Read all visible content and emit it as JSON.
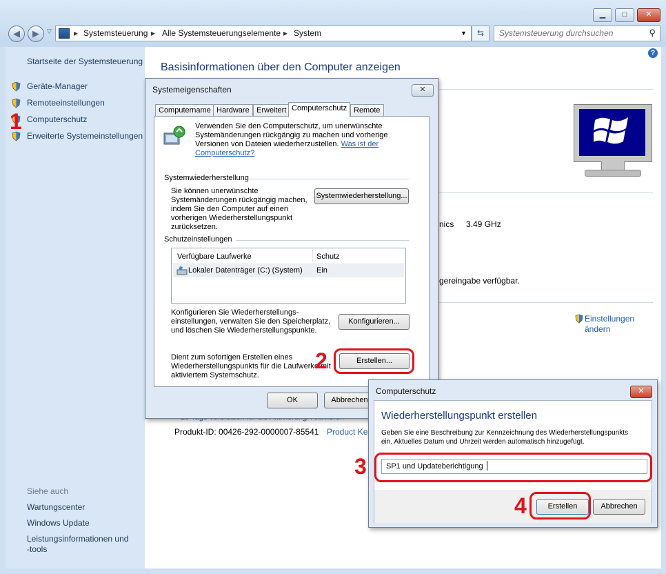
{
  "window": {
    "breadcrumbs": [
      "Systemsteuerung",
      "Alle Systemsteuerungselemente",
      "System"
    ],
    "search_placeholder": "Systemsteuerung durchsuchen",
    "caption_minimize": "▁",
    "caption_maximize": "□",
    "caption_close": "✕"
  },
  "sidebar": {
    "home": "Startseite der Systemsteuerung",
    "items": [
      {
        "label": "Geräte-Manager",
        "icon": "uac-shield-icon"
      },
      {
        "label": "Remoteeinstellungen",
        "icon": "uac-shield-icon"
      },
      {
        "label": "Computerschutz",
        "icon": "uac-shield-icon"
      },
      {
        "label": "Erweiterte Systemeinstellungen",
        "icon": "uac-shield-icon"
      }
    ],
    "see_also_header": "Siehe auch",
    "see_also": [
      "Wartungscenter",
      "Windows Update",
      "Leistungsinformationen und",
      "-tools"
    ]
  },
  "main": {
    "title": "Basisinformationen über den Computer anzeigen",
    "cpu_fragment": "nics",
    "cpu_speed": "3.49 GHz",
    "pen_fragment": "gereingabe verfügbar.",
    "settings_link_1": "Einstellungen",
    "settings_link_2": "ändern",
    "activation_fragment": "25 Tage verbleiben für die Aktivierung. Aktivieren",
    "product_id": "Produkt-ID: 00426-292-0000007-85541",
    "product_key_fragment": "Product Ke"
  },
  "sys_dialog": {
    "title": "Systemeigenschaften",
    "tabs": [
      "Computername",
      "Hardware",
      "Erweitert",
      "Computerschutz",
      "Remote"
    ],
    "active_tab": "Computerschutz",
    "intro_1": "Verwenden Sie den Computerschutz, um unerwünschte",
    "intro_2": "Systemänderungen rückgängig zu machen und vorherige",
    "intro_3": "Versionen von Dateien wiederherzustellen.",
    "intro_link_1": "Was ist der",
    "intro_link_2": "Computerschutz?",
    "restore_group": "Systemwiederherstellung",
    "restore_text": [
      "Sie können unerwünschte",
      "Systemänderungen rückgängig machen,",
      "indem Sie den Computer auf einen",
      "vorherigen Wiederherstellungspunkt",
      "zurücksetzen."
    ],
    "restore_button": "Systemwiederherstellung...",
    "protection_group": "Schutzeinstellungen",
    "columns": [
      "Verfügbare Laufwerke",
      "Schutz"
    ],
    "drives": [
      {
        "name": "Lokaler Datenträger (C:) (System)",
        "protection": "Ein"
      }
    ],
    "configure_text": [
      "Konfigurieren Sie Wiederherstellungs-",
      "einstellungen, verwalten Sie den Speicherplatz,",
      "und löschen Sie Wiederherstellungspunkte."
    ],
    "configure_button": "Konfigurieren...",
    "create_text": [
      "Dient zum sofortigen Erstellen eines",
      "Wiederherstellungspunkts für die Laufwerke mit",
      "aktiviertem Systemschutz."
    ],
    "create_button": "Erstellen...",
    "ok_button": "OK",
    "cancel_button": "Abbrechen"
  },
  "cp_dialog": {
    "title": "Computerschutz",
    "heading": "Wiederherstellungspunkt erstellen",
    "desc_1": "Geben Sie eine Beschreibung zur Kennzeichnung des Wiederherstellungspunkts",
    "desc_2": "ein. Aktuelles Datum und Uhrzeit werden automatisch hinzugefügt.",
    "input_value": "SP1 und Updateberichtigung",
    "create_button": "Erstellen",
    "cancel_button": "Abbrechen"
  },
  "annotations": {
    "step1": "1",
    "step2": "2",
    "step3": "3",
    "step4": "4",
    "color": "#e0131b"
  }
}
